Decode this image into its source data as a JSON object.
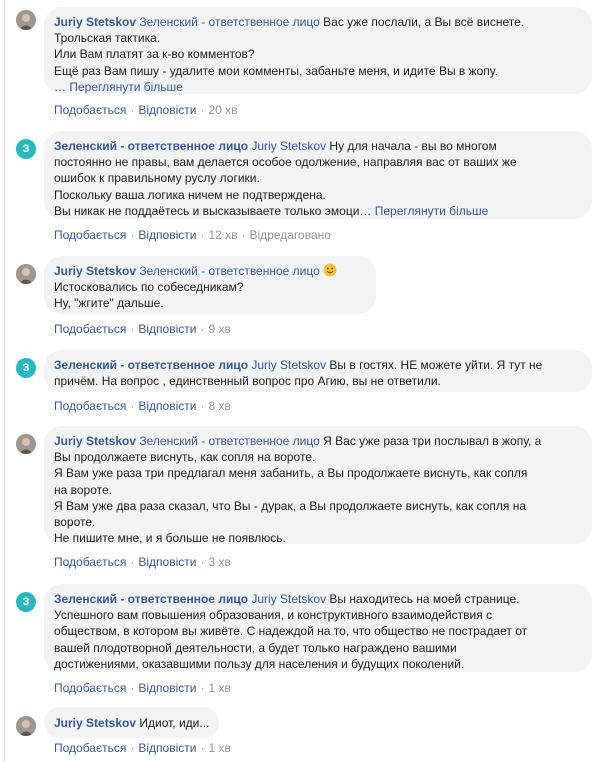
{
  "actions": {
    "like": "Подобається",
    "reply": "Відповісти",
    "see_more": "Переглянути більше",
    "edited": "Відредаговано",
    "separator": "·",
    "ellipsis": "…"
  },
  "avatar_letter": "З",
  "colors": {
    "link": "#385898",
    "bubble": "#f2f3f5",
    "letter_avatar": "#2ab8c0",
    "meta": "#90949c"
  },
  "comments": [
    {
      "author": "Juriy Stetskov",
      "mention": "Зеленский - ответственное лицо",
      "avatar": "photo",
      "lines": [
        "Вас уже послали, а Вы всё виснете.",
        "Трольская тактика.",
        "Или Вам платят за к-во комментов?",
        "Ещё раз Вам пишу - удалите мои комменты, забаньте меня, и идите Вы в жопу."
      ],
      "time": "20 хв"
    },
    {
      "author": "Зеленский - ответственное лицо",
      "mention": "Juriy Stetskov",
      "avatar": "letter",
      "first_line": "Ну для начала - вы во многом",
      "lines": [
        "постоянно не правы, вам делается особое одолжение, направляя вас от ваших же",
        "ошибок к правильному руслу логики.",
        "Поскольку ваша логика ничем не подтверждена.",
        "Вы никак не поддаётесь и высказываете только эмоци"
      ],
      "time": "12 хв"
    },
    {
      "author": "Juriy Stetskov",
      "mention": "Зеленский - ответственное лицо",
      "avatar": "photo",
      "lines": [
        "Истосковались по собеседникам?",
        "Ну, \"жгите\" дальше."
      ],
      "time": "9 хв"
    },
    {
      "author": "Зеленский - ответственное лицо",
      "mention": "Juriy Stetskov",
      "avatar": "letter",
      "first_line": "Вы в гостях. НЕ можете уйти. Я тут не",
      "lines": [
        "причём. На вопрос , единственный вопрос про Агию, вы не ответили."
      ],
      "time": "8 хв"
    },
    {
      "author": "Juriy Stetskov",
      "mention": "Зеленский - ответственное лицо",
      "avatar": "photo",
      "first_line": "Я Вас уже раза три послывал в жопу, а",
      "lines": [
        "Вы продолжаете виснуть, как сопля на вороте.",
        "Я Вам уже раза три предлагал меня забанить, а Вы продолжаете виснуть, как сопля",
        "на вороте.",
        "Я Вам уже два раза сказал, что Вы - дурак, а Вы продолжаете виснуть, как сопля на",
        "вороте.",
        "Не пишите мне, и я больше не появлюсь."
      ],
      "time": "3 хв"
    },
    {
      "author": "Зеленский - ответственное лицо",
      "mention": "Juriy Stetskov",
      "avatar": "letter",
      "first_line": "Вы находитесь на моей странице.",
      "lines": [
        "Успешного вам повышения образования, и конструктивного взаимодействия с",
        "обществом, в котором вы живёте. С надеждой на то, что общество не пострадает от",
        "вашей плодотворной деятельности, а будет только награждено вашими",
        "достижениями, оказавшими пользу для населения и будущих поколений."
      ],
      "time": "1 хв"
    },
    {
      "author": "Juriy Stetskov",
      "avatar": "photo",
      "first_line": "Идиот, иди...",
      "time": "1 хв"
    }
  ]
}
